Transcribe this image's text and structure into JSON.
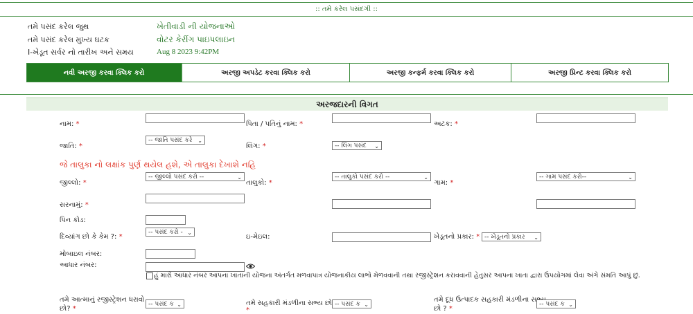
{
  "banner": ":: તમે કરેલ પસંદગી ::",
  "selection": {
    "group_label": "તમે પસંદ કરેલ જુથ",
    "group_value": "ખેતીવાડી ની યોજનાઓ",
    "component_label": "તમે પસંદ કરેલ મુખ્ય ઘટક",
    "component_value": "વોટર કેરીંગ પાઇપલાઇન",
    "server_label": "I-ખેડૂત સર્વર નો તારીખ અને સમય",
    "server_value": "Aug 8 2023 9:42PM"
  },
  "tabs": {
    "new": "નવી અરજી કરવા ક્લિક કરો",
    "update": "અરજી અપડેટ કરવા ક્લિક કરો",
    "confirm": "અરજી કન્ફર્મ કરવા ક્લિક કરો",
    "print": "અરજી પ્રિન્ટ કરવા ક્લિક કરો"
  },
  "section_title": "અરજદારની વિગત",
  "form": {
    "name_label": "નામ:",
    "father_label": "પિતા / પતિનું નામ:",
    "surname_label": "અટક:",
    "caste_label": "જાતિ:",
    "caste_select": "-- જાતિ પસંદ કરે",
    "gender_label": "લિંગ:",
    "gender_select": "-- લિંગ પસંદ",
    "notice": "જે તાલુકા નો લક્ષાંક પુર્ણ થયેલ હશે, એ તાલુકા દેખાશે નહિ",
    "district_label": "જીલ્લો:",
    "district_select": "-- જીલ્લો પસંદ કરો --",
    "taluka_label": "તાલુકો:",
    "taluka_select": "-- તાલુકો પસંદ કરો --",
    "village_label": "ગામ:",
    "village_select": "-- ગામ પસંદ કરો--",
    "address_label": "સરનામું:",
    "pincode_label": "પિન કોડ:",
    "disabled_label": "દિવ્યાંગ છો કે કેમ ?:",
    "disabled_select": "-- પસંદ કરો -",
    "email_label": "ઇ-મેઇલ:",
    "farmer_type_label": "ખેડૂતનો પ્રકાર:",
    "farmer_type_select": "-- ખેડૂતનો પ્રકાર",
    "mobile_label": "મોબાઇલ નંબર:",
    "aadhaar_label": "આધાર નંબર:",
    "consent_text": "હું મારો આધાર નંબર આપના ખાતાની યોજના અંતર્ગત મળવાપાત્ર યોજનાકીય લાભો મેળવવાની તથા રજીસ્ટ્રેશન કરાવવાની હેતુસર આપના ખાતા દ્વારા ઉપયોગમાં લેવા અંગે સંમતિ આપું છું.",
    "atma_label_1": "તમે આત્માનું રજીસ્ટ્રેશન ધરાવો",
    "atma_label_2": "છો?",
    "atma_select": "-- પસંદ ક",
    "coop_label": "તમે સહકારી મંડળીના સભ્ય છો ?",
    "coop_select": "-- પસંદ ક",
    "dairy_label_1": "તમે દૂધ ઉત્પાદક સહકારી મંડળીના સભ્ય",
    "dairy_label_2": "છો ?",
    "dairy_select": "-- પસંદ ક",
    "required_mark": "*"
  },
  "colors": {
    "primary_green": "#1f7a1f",
    "required_red": "#d21d1d",
    "notice_red": "#e0392b"
  }
}
